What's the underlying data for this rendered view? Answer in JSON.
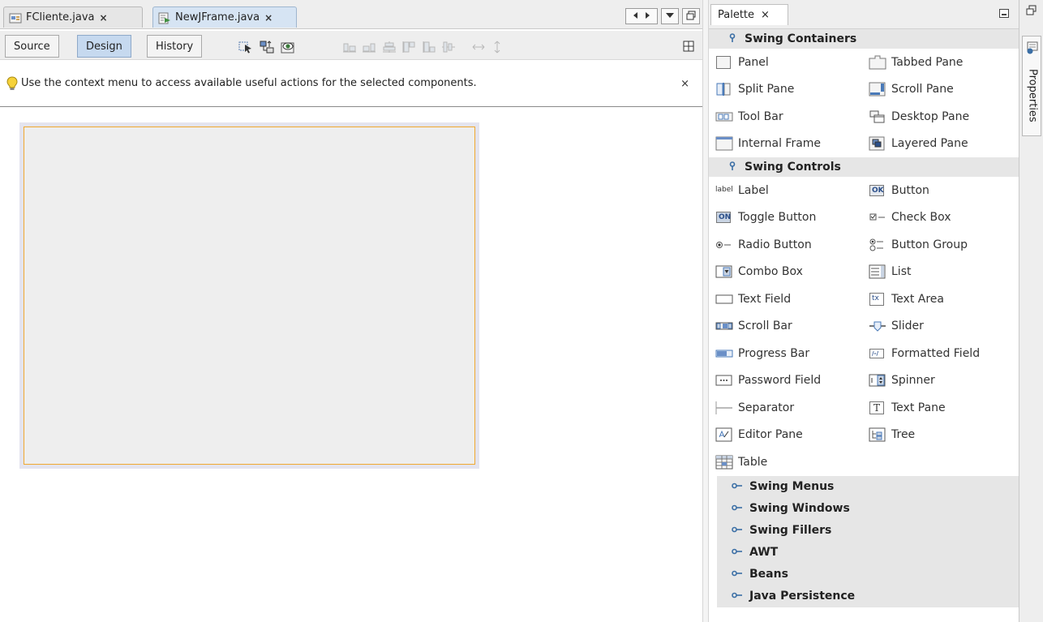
{
  "editor": {
    "tabs": [
      {
        "label": "FCliente.java",
        "close": "×"
      },
      {
        "label": "NewJFrame.java",
        "close": "×"
      }
    ],
    "toolbar": {
      "source_label": "Source",
      "design_label": "Design",
      "history_label": "History"
    },
    "hint": {
      "text": "Use the context menu to access available useful actions for the selected components.",
      "close": "×"
    }
  },
  "palette": {
    "title": "Palette",
    "close": "×",
    "categories": [
      {
        "name": "Swing Containers",
        "items": [
          "Panel",
          "Tabbed Pane",
          "Split Pane",
          "Scroll Pane",
          "Tool Bar",
          "Desktop Pane",
          "Internal Frame",
          "Layered Pane"
        ]
      },
      {
        "name": "Swing Controls",
        "items": [
          "Label",
          "Button",
          "Toggle Button",
          "Check Box",
          "Radio Button",
          "Button Group",
          "Combo Box",
          "List",
          "Text Field",
          "Text Area",
          "Scroll Bar",
          "Slider",
          "Progress Bar",
          "Formatted Field",
          "Password Field",
          "Spinner",
          "Separator",
          "Text Pane",
          "Editor Pane",
          "Tree",
          "Table"
        ]
      }
    ],
    "collapsed_categories": [
      "Swing Menus",
      "Swing Windows",
      "Swing Fillers",
      "AWT",
      "Beans",
      "Java Persistence"
    ],
    "icon_texts": {
      "label": "label",
      "button": "OK",
      "toggle": "ON",
      "text_area": "tx",
      "text_pane": "T",
      "formatted": "/-/"
    }
  },
  "sidebar": {
    "properties_label": "Properties"
  },
  "colors": {
    "accent": "#3a6ea5",
    "selection_border": "#f0a830",
    "canvas_bg": "#eeeeee"
  }
}
